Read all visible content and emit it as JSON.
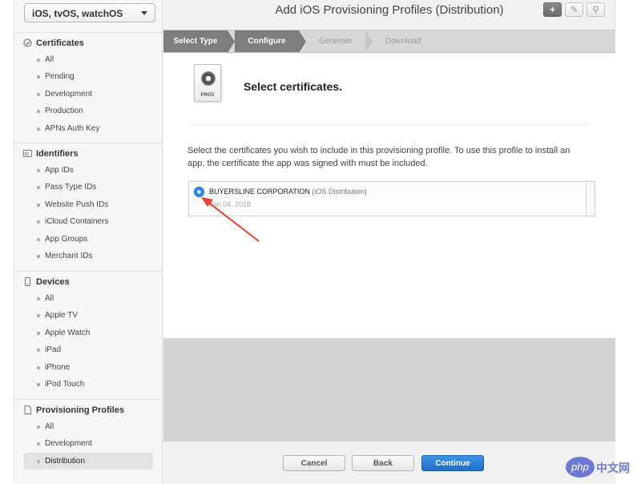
{
  "sidebar": {
    "platform": "iOS, tvOS, watchOS",
    "sections": [
      {
        "title": "Certificates",
        "icon": "certificate-icon",
        "items": [
          "All",
          "Pending",
          "Development",
          "Production",
          "APNs Auth Key"
        ]
      },
      {
        "title": "Identifiers",
        "icon": "id-icon",
        "items": [
          "App IDs",
          "Pass Type IDs",
          "Website Push IDs",
          "iCloud Containers",
          "App Groups",
          "Merchant IDs"
        ]
      },
      {
        "title": "Devices",
        "icon": "device-icon",
        "items": [
          "All",
          "Apple TV",
          "Apple Watch",
          "iPad",
          "iPhone",
          "iPod Touch"
        ]
      },
      {
        "title": "Provisioning Profiles",
        "icon": "document-icon",
        "items": [
          "All",
          "Development",
          "Distribution"
        ],
        "selected": "Distribution"
      }
    ]
  },
  "header": {
    "title": "Add iOS Provisioning Profiles (Distribution)",
    "buttons": {
      "add": "+",
      "edit": "✎",
      "search": "⚲"
    }
  },
  "steps": [
    {
      "label": "Select Type",
      "state": "done"
    },
    {
      "label": "Configure",
      "state": "current"
    },
    {
      "label": "Generate",
      "state": "todo"
    },
    {
      "label": "Download",
      "state": "todo"
    }
  ],
  "content": {
    "prov_label": "PROV",
    "section_title": "Select certificates.",
    "instructions": "Select the certificates you wish to include in this provisioning profile. To use this profile to install an app, the certificate the app was signed with must be included.",
    "certificate": {
      "name": "BUYERSLINE CORPORATION",
      "type": "(iOS Distribution)",
      "date": "Jan 04, 2018",
      "selected": true
    }
  },
  "footer": {
    "cancel": "Cancel",
    "back": "Back",
    "continue": "Continue"
  },
  "watermark": {
    "logo": "php",
    "text": "中文网"
  },
  "colors": {
    "accent": "#2d8ce6",
    "step_done": "#7d7d7d",
    "annotation_arrow": "#e8402f",
    "primary_button": "#1e6ec7"
  }
}
